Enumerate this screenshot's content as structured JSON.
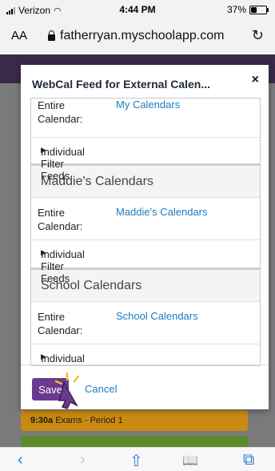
{
  "status": {
    "carrier": "Verizon",
    "time": "4:44 PM",
    "battery": "37%",
    "battery_level": 0.37
  },
  "browser": {
    "aa_label": "AA",
    "url": "fatherryan.myschoolapp.com"
  },
  "modal": {
    "title": "WebCal Feed for External Calen...",
    "close": "×",
    "entire_calendar_label": "Entire Calendar:",
    "filter_feeds_label": "Individual Filter Feeds",
    "sections": [
      {
        "heading": "",
        "link": "My Calendars"
      },
      {
        "heading": "Maddie's Calendars",
        "link": "Maddie's Calendars"
      },
      {
        "heading": "School Calendars",
        "link": "School Calendars"
      }
    ],
    "save_label": "Save",
    "cancel_label": "Cancel"
  },
  "background": {
    "event1": {
      "time": "9:30a",
      "text": "Exams - Period 1"
    }
  },
  "toolbar": {
    "back": "‹",
    "forward": "›",
    "share": "⇧",
    "bookmarks": "📖",
    "tabs": "⧉"
  }
}
